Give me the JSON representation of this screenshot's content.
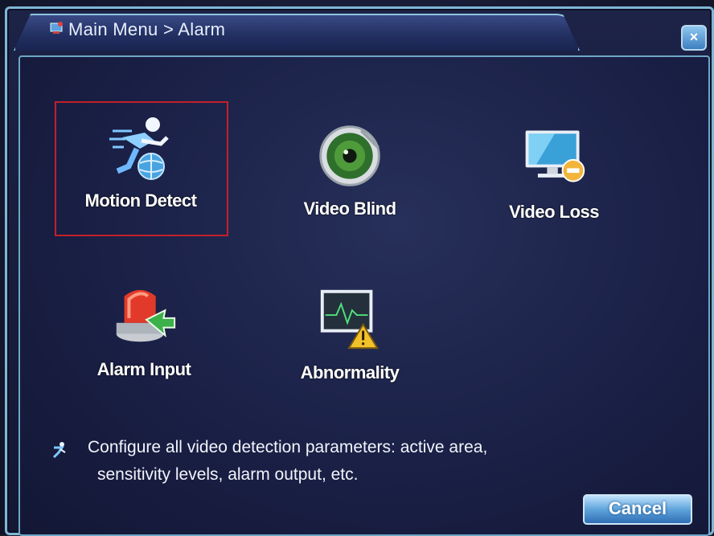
{
  "window": {
    "title": "Main Menu > Alarm",
    "close_symbol": "×"
  },
  "menu": {
    "items": [
      {
        "label": "Motion Detect",
        "icon": "motion-detect-icon",
        "selected": true
      },
      {
        "label": "Video Blind",
        "icon": "video-blind-icon",
        "selected": false
      },
      {
        "label": "Video Loss",
        "icon": "video-loss-icon",
        "selected": false
      },
      {
        "label": "Alarm Input",
        "icon": "alarm-input-icon",
        "selected": false
      },
      {
        "label": "Abnormality",
        "icon": "abnormality-icon",
        "selected": false
      }
    ]
  },
  "hint": {
    "icon": "motion-detect-small-icon",
    "line1": "Configure all video detection parameters: active area,",
    "line2": "sensitivity levels, alarm output, etc."
  },
  "footer": {
    "cancel_label": "Cancel"
  },
  "colors": {
    "selection_border": "#c3202a",
    "frame": "#7fb6d6",
    "background": "#1a2046"
  }
}
